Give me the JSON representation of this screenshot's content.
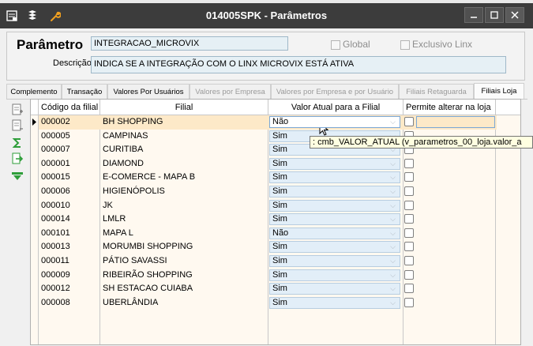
{
  "window": {
    "title": "014005SPK - Parâmetros",
    "icons": [
      "app-menu-icon",
      "layers-icon",
      "wrench-icon"
    ],
    "buttons": [
      "minimize-icon",
      "maximize-icon",
      "close-icon"
    ]
  },
  "parameter": {
    "label": "Parâmetro",
    "value": "INTEGRACAO_MICROVIX",
    "description_label": "Descrição",
    "description_value": "INDICA SE A INTEGRAÇÃO COM O LINX MICROVIX ESTÁ ATIVA",
    "global_label": "Global",
    "global_checked": false,
    "exclusivo_label": "Exclusivo Linx",
    "exclusivo_checked": false
  },
  "tabs": [
    {
      "label": "Complemento",
      "enabled": true,
      "active": false
    },
    {
      "label": "Transação",
      "enabled": true,
      "active": false
    },
    {
      "label": "Valores Por Usuários",
      "enabled": true,
      "active": false
    },
    {
      "label": "Valores por Empresa",
      "enabled": false,
      "active": false
    },
    {
      "label": "Valores por Empresa e por Usuário",
      "enabled": false,
      "active": false
    },
    {
      "label": "Filiais Retaguarda",
      "enabled": false,
      "active": false
    },
    {
      "label": "Filiais Loja",
      "enabled": true,
      "active": true
    }
  ],
  "toolbar_icons": [
    "add-row-icon",
    "delete-row-icon",
    "sum-icon",
    "export-icon",
    "filter-icon"
  ],
  "grid": {
    "headers": {
      "codigo": "Código da filial",
      "filial": "Filial",
      "valor": "Valor Atual para a Filial",
      "permite": "Permite alterar na loja"
    },
    "rows": [
      {
        "codigo": "000002",
        "filial": "BH SHOPPING",
        "valor": "Não",
        "permite": false,
        "selected": true
      },
      {
        "codigo": "000005",
        "filial": "CAMPINAS",
        "valor": "Sim",
        "permite": false
      },
      {
        "codigo": "000007",
        "filial": "CURITIBA",
        "valor": "Sim",
        "permite": false
      },
      {
        "codigo": "000001",
        "filial": "DIAMOND",
        "valor": "Sim",
        "permite": false
      },
      {
        "codigo": "000015",
        "filial": "E-COMERCE - MAPA B",
        "valor": "Sim",
        "permite": false
      },
      {
        "codigo": "000006",
        "filial": "HIGIENÓPOLIS",
        "valor": "Sim",
        "permite": false
      },
      {
        "codigo": "000010",
        "filial": "JK",
        "valor": "Sim",
        "permite": false
      },
      {
        "codigo": "000014",
        "filial": "LMLR",
        "valor": "Sim",
        "permite": false
      },
      {
        "codigo": "000101",
        "filial": "MAPA L",
        "valor": "Não",
        "permite": false
      },
      {
        "codigo": "000013",
        "filial": "MORUMBI SHOPPING",
        "valor": "Sim",
        "permite": false
      },
      {
        "codigo": "000011",
        "filial": "PÁTIO SAVASSI",
        "valor": "Sim",
        "permite": false
      },
      {
        "codigo": "000009",
        "filial": "RIBEIRÃO SHOPPING",
        "valor": "Sim",
        "permite": false
      },
      {
        "codigo": "000012",
        "filial": "SH ESTACAO CUIABA",
        "valor": "Sim",
        "permite": false
      },
      {
        "codigo": "000008",
        "filial": "UBERLÂNDIA",
        "valor": "Sim",
        "permite": false
      }
    ]
  },
  "tooltip": ": cmb_VALOR_ATUAL (v_parametros_00_loja.valor_a",
  "colors": {
    "titlebar": "#3c3c3c",
    "grid_background": "#fff9f0",
    "selected_row": "#fde9c8",
    "field_background": "#e6f0f5",
    "tooltip_background": "#ffffe1"
  }
}
